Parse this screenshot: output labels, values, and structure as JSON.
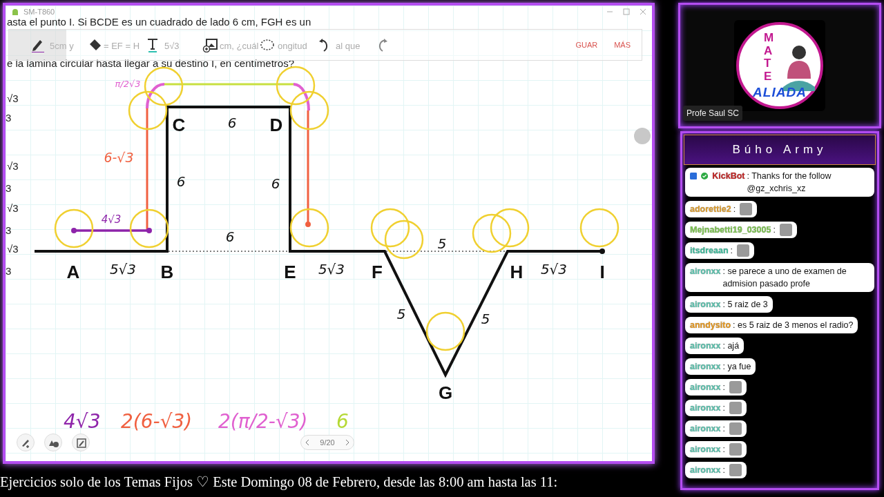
{
  "window": {
    "title": "SM-T860"
  },
  "toolbar": {
    "tools": [
      {
        "kind": "pen",
        "selected": true
      },
      {
        "kind": "eraser",
        "selected": false
      },
      {
        "kind": "text",
        "selected": false
      },
      {
        "kind": "image",
        "selected": false
      },
      {
        "kind": "lasso",
        "selected": false
      },
      {
        "kind": "undo",
        "selected": false
      },
      {
        "kind": "redo",
        "selected": false
      }
    ],
    "actions": [
      "GUAR",
      "MÁS"
    ]
  },
  "question_lines": [
    "asta el punto I. Si BCDE es un cuadrado de lado 6 cm, FGH es un",
    "e la lamina circular hasta llegar a su destino I, en centímetros?"
  ],
  "question_fragments_under_toolbar": [
    "5cm y",
    "= EF = H",
    "5√3",
    "cm, ¿cuál",
    "ongitud",
    "al que"
  ],
  "margin_fractions": [
    {
      "numerator": "√3",
      "denominator": "3"
    },
    {
      "numerator": "√3",
      "denominator": "3"
    },
    {
      "numerator": "√3",
      "denominator": "3"
    },
    {
      "numerator": "√3",
      "denominator": "3"
    }
  ],
  "diagram": {
    "vertex_labels": [
      "C",
      "D",
      "A",
      "B",
      "E",
      "F",
      "H",
      "I",
      "G"
    ],
    "lengths": [
      "6",
      "6",
      "6",
      "6",
      "5",
      "5√3",
      "5√3",
      "5√3",
      "5",
      "5"
    ],
    "annotations": [
      {
        "text": "π/2√3",
        "color": "#e060d0"
      },
      {
        "text": "6-√3",
        "color": "#f06040"
      },
      {
        "text": "4√3",
        "color": "#8e24aa"
      }
    ]
  },
  "work": [
    {
      "text": "4√3",
      "color": "#8e24aa"
    },
    {
      "text": "2(6-√3)",
      "color": "#f06040"
    },
    {
      "text": "2(π/2-√3)",
      "color": "#e060d0"
    },
    {
      "text": "6",
      "color": "#b5d935"
    }
  ],
  "pager": {
    "page": "9/20"
  },
  "ticker": "Ejercicios solo de los Temas Fijos ♡  Este Domingo 08 de Febrero, desde las 8:00 am hasta las 11:",
  "camera": {
    "name": "Profe Saul SC",
    "logo_vertical": "MATE",
    "logo_bottom": "ALIADA"
  },
  "chat": {
    "title": "Búho Army",
    "messages": [
      {
        "user": "KickBot",
        "color": "#c62828",
        "bot": true,
        "kind": "text",
        "text": ": Thanks for the follow @gz_xchris_xz"
      },
      {
        "user": "adorettie2",
        "color": "#e0a030",
        "bot": false,
        "kind": "emote",
        "text": ":"
      },
      {
        "user": "Mejnabetti19_03005",
        "color": "#7ec850",
        "bot": false,
        "kind": "emote",
        "text": ":"
      },
      {
        "user": "itsdreaan",
        "color": "#3fbf9f",
        "bot": false,
        "kind": "emote",
        "text": ":"
      },
      {
        "user": "aironxx",
        "color": "#5cc5b0",
        "bot": false,
        "kind": "text",
        "text": ": se parece a uno de examen de admision pasado profe"
      },
      {
        "user": "aironxx",
        "color": "#5cc5b0",
        "bot": false,
        "kind": "text",
        "text": ": 5 raiz de 3"
      },
      {
        "user": "anndysito",
        "color": "#e89a20",
        "bot": false,
        "kind": "text",
        "text": ": es 5 raiz de 3 menos el radio?"
      },
      {
        "user": "aironxx",
        "color": "#5cc5b0",
        "bot": false,
        "kind": "text",
        "text": ": ajá"
      },
      {
        "user": "aironxx",
        "color": "#5cc5b0",
        "bot": false,
        "kind": "text",
        "text": ": ya fue"
      },
      {
        "user": "aironxx",
        "color": "#5cc5b0",
        "bot": false,
        "kind": "emote",
        "text": ":"
      },
      {
        "user": "aironxx",
        "color": "#5cc5b0",
        "bot": false,
        "kind": "emote",
        "text": ":"
      },
      {
        "user": "aironxx",
        "color": "#5cc5b0",
        "bot": false,
        "kind": "emote",
        "text": ":"
      },
      {
        "user": "aironxx",
        "color": "#5cc5b0",
        "bot": false,
        "kind": "emote",
        "text": ":"
      },
      {
        "user": "aironxx",
        "color": "#5cc5b0",
        "bot": false,
        "kind": "emote",
        "text": ":"
      }
    ]
  }
}
